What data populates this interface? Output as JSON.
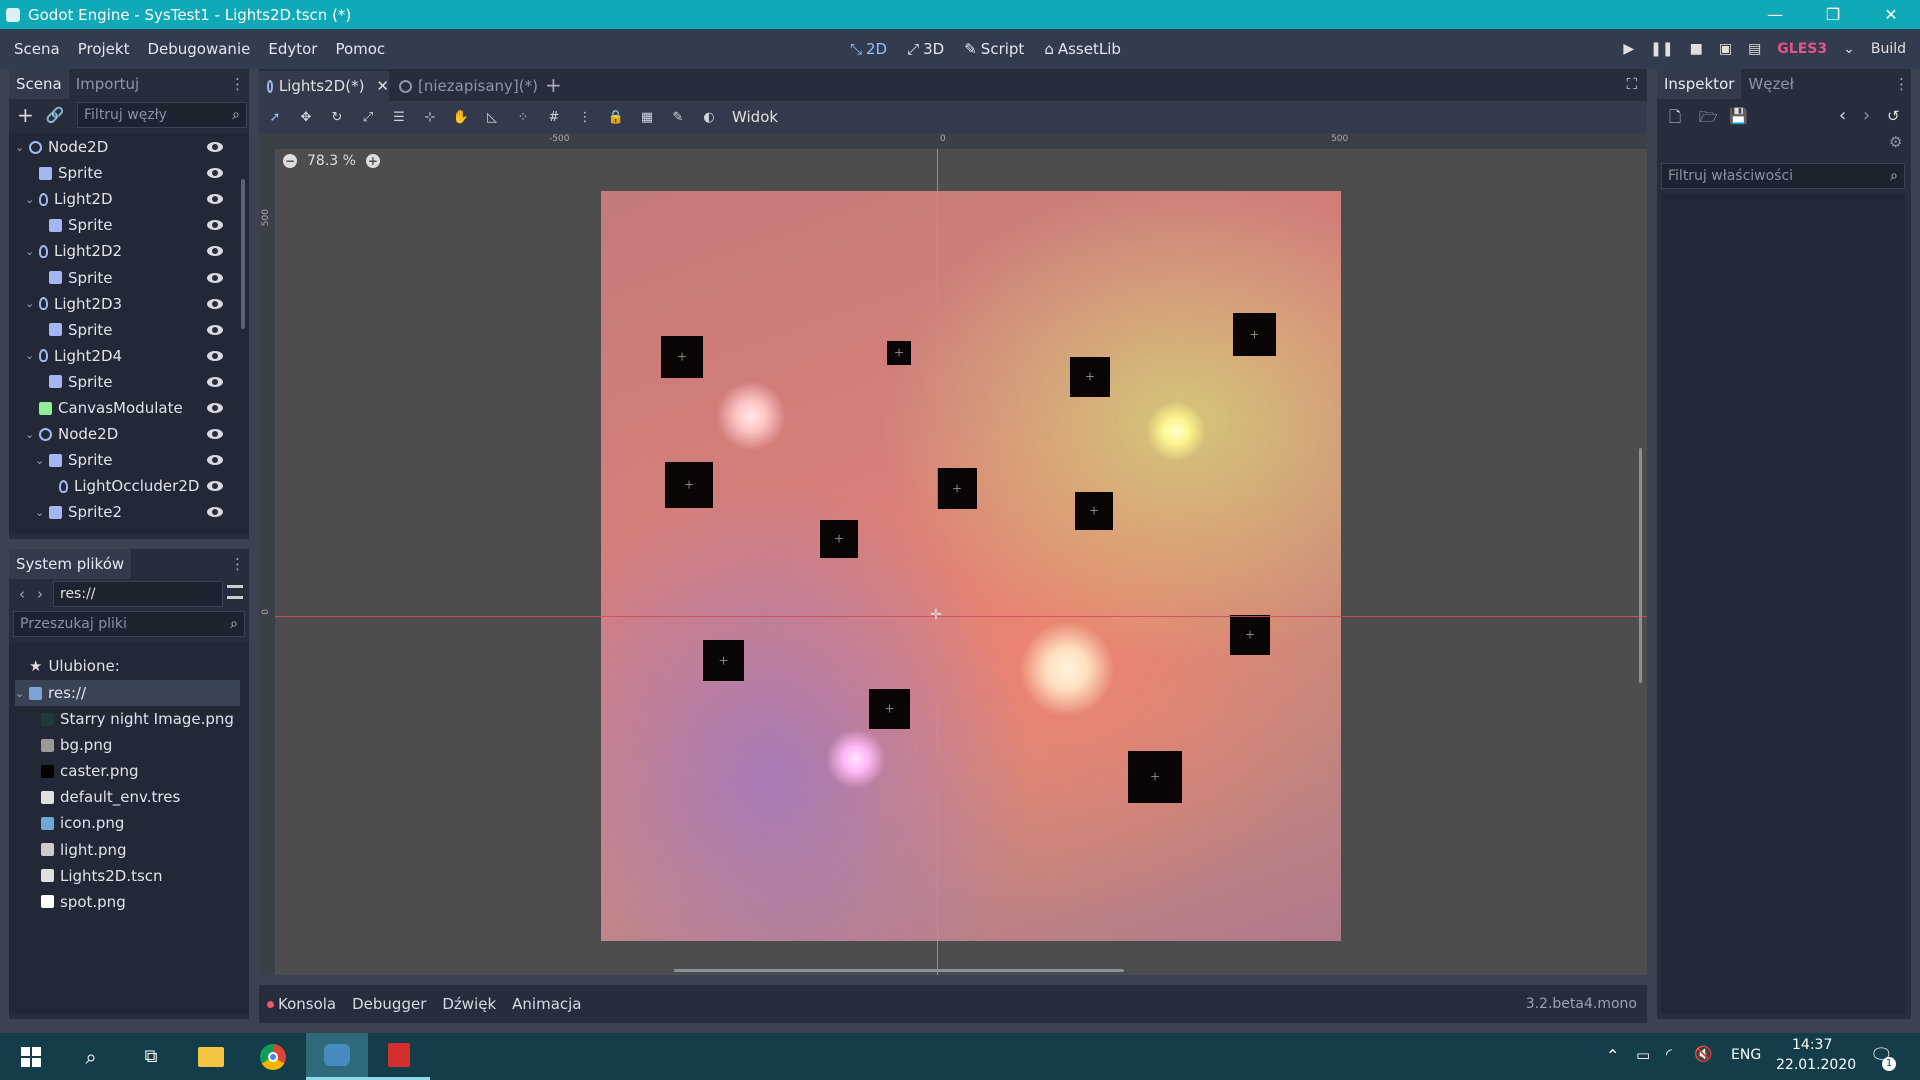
{
  "window": {
    "title": "Godot Engine - SysTest1 - Lights2D.tscn (*)"
  },
  "menu": [
    "Scena",
    "Projekt",
    "Debugowanie",
    "Edytor",
    "Pomoc"
  ],
  "modes": [
    {
      "label": "2D",
      "glyph": "⤡"
    },
    {
      "label": "3D",
      "glyph": "⤢"
    },
    {
      "label": "Script",
      "glyph": "✎"
    },
    {
      "label": "AssetLib",
      "glyph": "⌂"
    }
  ],
  "run": {
    "renderer": "GLES3",
    "build_label": "Build"
  },
  "scene_dock": {
    "tabs": [
      "Scena",
      "Importuj"
    ],
    "filter_placeholder": "Filtruj węzły",
    "nodes": [
      {
        "label": "Node2D",
        "type": "node",
        "caret": "⌄"
      },
      {
        "label": "Sprite",
        "type": "sprite",
        "caret": ""
      },
      {
        "label": "Light2D",
        "type": "light",
        "caret": "⌄"
      },
      {
        "label": "Sprite",
        "type": "sprite",
        "caret": ""
      },
      {
        "label": "Light2D2",
        "type": "light",
        "caret": "⌄"
      },
      {
        "label": "Sprite",
        "type": "sprite",
        "caret": ""
      },
      {
        "label": "Light2D3",
        "type": "light",
        "caret": "⌄"
      },
      {
        "label": "Sprite",
        "type": "sprite",
        "caret": ""
      },
      {
        "label": "Light2D4",
        "type": "light",
        "caret": "⌄"
      },
      {
        "label": "Sprite",
        "type": "sprite",
        "caret": ""
      },
      {
        "label": "CanvasModulate",
        "type": "canvas",
        "caret": ""
      },
      {
        "label": "Node2D",
        "type": "node",
        "caret": "⌄"
      },
      {
        "label": "Sprite",
        "type": "sprite",
        "caret": "⌄"
      },
      {
        "label": "LightOccluder2D",
        "type": "light",
        "caret": ""
      },
      {
        "label": "Sprite2",
        "type": "sprite",
        "caret": "⌄"
      }
    ]
  },
  "filesystem": {
    "title": "System plików",
    "path": "res://",
    "search_placeholder": "Przeszukaj pliki",
    "favorites_label": "Ulubione:",
    "root_label": "res://",
    "files": [
      {
        "name": "Starry night Image.png",
        "color": "#1f3a3a"
      },
      {
        "name": "bg.png",
        "color": "#9a9a9a"
      },
      {
        "name": "caster.png",
        "color": "#000000"
      },
      {
        "name": "default_env.tres",
        "color": "#e0e0e0"
      },
      {
        "name": "icon.png",
        "color": "#6ea7d8"
      },
      {
        "name": "light.png",
        "color": "#cccccc"
      },
      {
        "name": "Lights2D.tscn",
        "color": "#e0e0e0"
      },
      {
        "name": "spot.png",
        "color": "#ffffff"
      }
    ]
  },
  "editor_tabs": [
    {
      "label": "Lights2D(*)",
      "active": true
    },
    {
      "label": "[niezapisany](*)",
      "active": false
    }
  ],
  "toolbar": {
    "view_menu": "Widok",
    "zoom": "78.3 %"
  },
  "rulers": {
    "h_labels": [
      "-500",
      "0",
      "500"
    ],
    "v_labels": [
      "500",
      "0"
    ]
  },
  "inspector": {
    "tabs": [
      "Inspektor",
      "Węzeł"
    ],
    "filter_placeholder": "Filtruj właściwości"
  },
  "bottom_panel": {
    "tabs": [
      "Konsola",
      "Debugger",
      "Dźwięk",
      "Animacja"
    ],
    "version": "3.2.beta4.mono"
  },
  "taskbar": {
    "language": "ENG",
    "time": "14:37",
    "date": "22.01.2020",
    "notif_count": "1"
  }
}
